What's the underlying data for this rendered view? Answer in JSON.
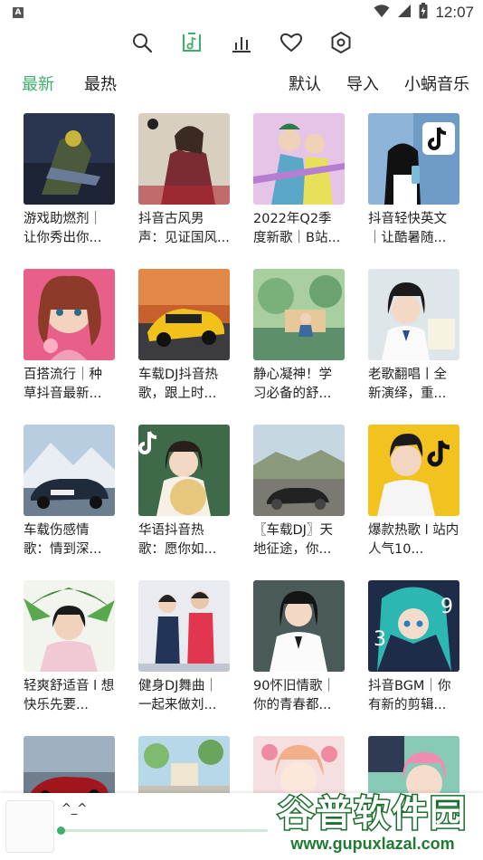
{
  "status_bar": {
    "notification_icon_label": "A",
    "time": "12:07"
  },
  "top_icons": [
    "search-icon",
    "music-note-icon",
    "bar-chart-icon",
    "heart-icon",
    "settings-icon"
  ],
  "accent_color": "#3fae6b",
  "tabs": {
    "latest": "最新",
    "hot": "最热",
    "default": "默认",
    "import": "导入",
    "source": "小蜗音乐"
  },
  "playlists": [
    {
      "title": "游戏助燃剂｜让你秀出你..."
    },
    {
      "title": "抖音古风男声：见证国风..."
    },
    {
      "title": "2022年Q2季度新歌｜B站..."
    },
    {
      "title": "抖音轻快英文｜让酷暑随..."
    },
    {
      "title": "百搭流行｜种草抖音最新..."
    },
    {
      "title": "车载DJ抖音热歌，跟上时..."
    },
    {
      "title": "静心凝神！学习必备的舒..."
    },
    {
      "title": "老歌翻唱丨全新演绎，重..."
    },
    {
      "title": "车载伤感情歌：情到深..."
    },
    {
      "title": "华语抖音热歌：愿你如..."
    },
    {
      "title": "〖车载DJ〗天地征途，你..."
    },
    {
      "title": "爆款热歌 l 站内人气10..."
    },
    {
      "title": "轻爽舒适音 l 想快乐先要..."
    },
    {
      "title": "健身DJ舞曲｜一起来做刘..."
    },
    {
      "title": "90怀旧情歌｜你的青春都..."
    },
    {
      "title": "抖音BGM｜你有新的剪辑..."
    },
    {
      "title": ""
    },
    {
      "title": ""
    },
    {
      "title": ""
    },
    {
      "title": ""
    }
  ],
  "player": {
    "title": "^_^",
    "progress": 0.0
  },
  "watermark": {
    "main": "谷普软件园",
    "url": "www.gupuxlazal.com"
  }
}
